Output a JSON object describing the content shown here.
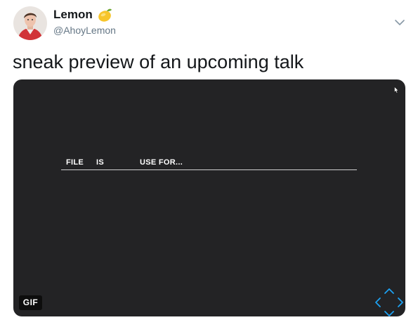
{
  "tweet": {
    "author": {
      "display_name": "Lemon",
      "handle": "@AhoyLemon",
      "emoji_icon": "lemon-icon"
    },
    "text": "sneak preview of an upcoming talk",
    "menu_icon": "chevron-down-icon"
  },
  "media": {
    "badge": "GIF",
    "table_headers": [
      "FILE",
      "IS",
      "USE FOR..."
    ],
    "background_color": "#232325",
    "accent_color": "#1da1f2"
  }
}
